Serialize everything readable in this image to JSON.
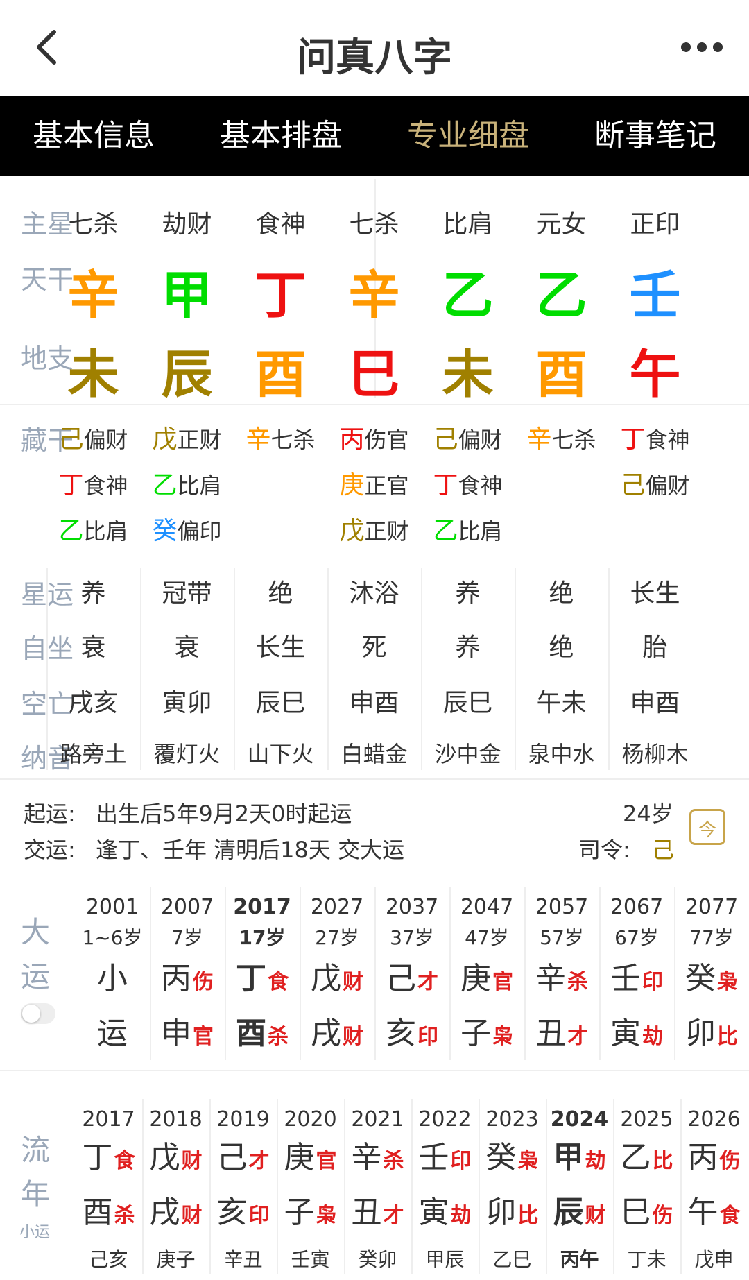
{
  "header": {
    "title": "问真八字"
  },
  "tabs": [
    "基本信息",
    "基本排盘",
    "专业细盘",
    "断事笔记"
  ],
  "active_tab": 2,
  "colors": {
    "orange": "#ff9900",
    "green": "#00dd00",
    "red": "#ee1111",
    "blue": "#1e90ff",
    "olive": "#a08000",
    "label": "#9aa7b8",
    "accent": "#c9b27a"
  },
  "labels": {
    "zhuxing": "主星",
    "tiangan": "天干",
    "dizhi": "地支",
    "canggan": "藏干",
    "xingyun": "星运",
    "zizuo": "自坐",
    "kongwang": "空亡",
    "nayin": "纳音",
    "dayun": "大运",
    "liunian": "流年",
    "xiaoyun": "小运"
  },
  "pillars": [
    {
      "zhuxing": "七杀",
      "gan": "辛",
      "gan_color": "#ff9900",
      "zhi": "未",
      "zhi_color": "#a08000",
      "canggan": [
        {
          "stem": "己",
          "color": "#a08000",
          "god": "偏财"
        },
        {
          "stem": "丁",
          "color": "#ee1111",
          "god": "食神"
        },
        {
          "stem": "乙",
          "color": "#00dd00",
          "god": "比肩"
        }
      ],
      "xingyun": "养",
      "zizuo": "衰",
      "kongwang": "戌亥",
      "nayin": "路旁土"
    },
    {
      "zhuxing": "劫财",
      "gan": "甲",
      "gan_color": "#00dd00",
      "zhi": "辰",
      "zhi_color": "#a08000",
      "canggan": [
        {
          "stem": "戊",
          "color": "#a08000",
          "god": "正财"
        },
        {
          "stem": "乙",
          "color": "#00dd00",
          "god": "比肩"
        },
        {
          "stem": "癸",
          "color": "#1e90ff",
          "god": "偏印"
        }
      ],
      "xingyun": "冠带",
      "zizuo": "衰",
      "kongwang": "寅卯",
      "nayin": "覆灯火"
    },
    {
      "zhuxing": "食神",
      "gan": "丁",
      "gan_color": "#ee1111",
      "zhi": "酉",
      "zhi_color": "#ff9900",
      "canggan": [
        {
          "stem": "辛",
          "color": "#ff9900",
          "god": "七杀"
        }
      ],
      "xingyun": "绝",
      "zizuo": "长生",
      "kongwang": "辰巳",
      "nayin": "山下火"
    },
    {
      "zhuxing": "七杀",
      "gan": "辛",
      "gan_color": "#ff9900",
      "zhi": "巳",
      "zhi_color": "#ee1111",
      "canggan": [
        {
          "stem": "丙",
          "color": "#ee1111",
          "god": "伤官"
        },
        {
          "stem": "庚",
          "color": "#ff9900",
          "god": "正官"
        },
        {
          "stem": "戊",
          "color": "#a08000",
          "god": "正财"
        }
      ],
      "xingyun": "沐浴",
      "zizuo": "死",
      "kongwang": "申酉",
      "nayin": "白蜡金"
    },
    {
      "zhuxing": "比肩",
      "gan": "乙",
      "gan_color": "#00dd00",
      "zhi": "未",
      "zhi_color": "#a08000",
      "canggan": [
        {
          "stem": "己",
          "color": "#a08000",
          "god": "偏财"
        },
        {
          "stem": "丁",
          "color": "#ee1111",
          "god": "食神"
        },
        {
          "stem": "乙",
          "color": "#00dd00",
          "god": "比肩"
        }
      ],
      "xingyun": "养",
      "zizuo": "养",
      "kongwang": "辰巳",
      "nayin": "沙中金"
    },
    {
      "zhuxing": "元女",
      "gan": "乙",
      "gan_color": "#00dd00",
      "zhi": "酉",
      "zhi_color": "#ff9900",
      "canggan": [
        {
          "stem": "辛",
          "color": "#ff9900",
          "god": "七杀"
        }
      ],
      "xingyun": "绝",
      "zizuo": "绝",
      "kongwang": "午未",
      "nayin": "泉中水"
    },
    {
      "zhuxing": "正印",
      "gan": "壬",
      "gan_color": "#1e90ff",
      "zhi": "午",
      "zhi_color": "#ee1111",
      "canggan": [
        {
          "stem": "丁",
          "color": "#ee1111",
          "god": "食神"
        },
        {
          "stem": "己",
          "color": "#a08000",
          "god": "偏财"
        }
      ],
      "xingyun": "长生",
      "zizuo": "胎",
      "kongwang": "申酉",
      "nayin": "杨柳木"
    }
  ],
  "qiyun": {
    "label1": "起运:",
    "text1": "出生后5年9月2天0时起运",
    "label2": "交运:",
    "text2": "逢丁、壬年 清明后18天 交大运",
    "age": "24岁",
    "siling_label": "司令:",
    "siling_value": "己",
    "calendar_icon_text": "今"
  },
  "dayun": [
    {
      "year": "2001",
      "age": "1~6岁",
      "gan": "小",
      "gan_ss": "",
      "zhi": "运",
      "zhi_ss": ""
    },
    {
      "year": "2007",
      "age": "7岁",
      "gan": "丙",
      "gan_ss": "伤",
      "zhi": "申",
      "zhi_ss": "官"
    },
    {
      "year": "2017",
      "age": "17岁",
      "gan": "丁",
      "gan_ss": "食",
      "zhi": "酉",
      "zhi_ss": "杀",
      "current": true
    },
    {
      "year": "2027",
      "age": "27岁",
      "gan": "戊",
      "gan_ss": "财",
      "zhi": "戌",
      "zhi_ss": "财"
    },
    {
      "year": "2037",
      "age": "37岁",
      "gan": "己",
      "gan_ss": "才",
      "zhi": "亥",
      "zhi_ss": "印"
    },
    {
      "year": "2047",
      "age": "47岁",
      "gan": "庚",
      "gan_ss": "官",
      "zhi": "子",
      "zhi_ss": "枭"
    },
    {
      "year": "2057",
      "age": "57岁",
      "gan": "辛",
      "gan_ss": "杀",
      "zhi": "丑",
      "zhi_ss": "才"
    },
    {
      "year": "2067",
      "age": "67岁",
      "gan": "壬",
      "gan_ss": "印",
      "zhi": "寅",
      "zhi_ss": "劫"
    },
    {
      "year": "2077",
      "age": "77岁",
      "gan": "癸",
      "gan_ss": "枭",
      "zhi": "卯",
      "zhi_ss": "比"
    }
  ],
  "liunian": [
    {
      "year": "2017",
      "gan": "丁",
      "gan_ss": "食",
      "zhi": "酉",
      "zhi_ss": "杀",
      "xiaoyun": "己亥"
    },
    {
      "year": "2018",
      "gan": "戊",
      "gan_ss": "财",
      "zhi": "戌",
      "zhi_ss": "财",
      "xiaoyun": "庚子"
    },
    {
      "year": "2019",
      "gan": "己",
      "gan_ss": "才",
      "zhi": "亥",
      "zhi_ss": "印",
      "xiaoyun": "辛丑"
    },
    {
      "year": "2020",
      "gan": "庚",
      "gan_ss": "官",
      "zhi": "子",
      "zhi_ss": "枭",
      "xiaoyun": "壬寅"
    },
    {
      "year": "2021",
      "gan": "辛",
      "gan_ss": "杀",
      "zhi": "丑",
      "zhi_ss": "才",
      "xiaoyun": "癸卯"
    },
    {
      "year": "2022",
      "gan": "壬",
      "gan_ss": "印",
      "zhi": "寅",
      "zhi_ss": "劫",
      "xiaoyun": "甲辰"
    },
    {
      "year": "2023",
      "gan": "癸",
      "gan_ss": "枭",
      "zhi": "卯",
      "zhi_ss": "比",
      "xiaoyun": "乙巳"
    },
    {
      "year": "2024",
      "gan": "甲",
      "gan_ss": "劫",
      "zhi": "辰",
      "zhi_ss": "财",
      "xiaoyun": "丙午",
      "current": true
    },
    {
      "year": "2025",
      "gan": "乙",
      "gan_ss": "比",
      "zhi": "巳",
      "zhi_ss": "伤",
      "xiaoyun": "丁未"
    },
    {
      "year": "2026",
      "gan": "丙",
      "gan_ss": "伤",
      "zhi": "午",
      "zhi_ss": "食",
      "xiaoyun": "戊申"
    }
  ]
}
